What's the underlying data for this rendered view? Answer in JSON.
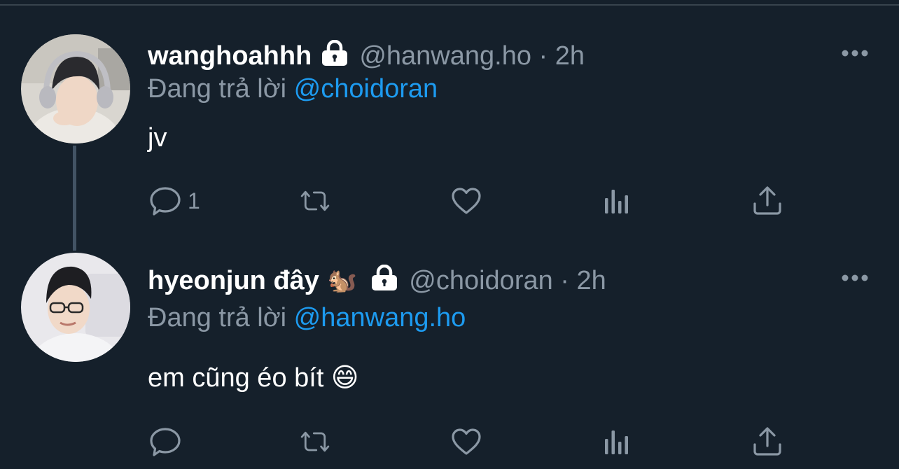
{
  "colors": {
    "background": "#15202b",
    "secondary_text": "#8b98a5",
    "mention": "#1d9bf0",
    "thread_line": "#425364"
  },
  "tweets": [
    {
      "display_name": "wanghoahhh",
      "lock_icon": "lock-icon",
      "handle_time": "@hanwang.ho · 2h",
      "reply_prefix": "Đang trả lời",
      "reply_to": "@choidoran",
      "text": "jv",
      "actions": {
        "reply_count": "1",
        "icons": [
          "reply-icon",
          "retweet-icon",
          "like-icon",
          "analytics-icon",
          "share-icon"
        ]
      }
    },
    {
      "display_name": "hyeonjun đây",
      "name_emoji": "🐿️",
      "lock_icon": "lock-icon",
      "handle_time": "@choidoran · 2h",
      "reply_prefix": "Đang trả lời",
      "reply_to": "@hanwang.ho",
      "text": "em cũng éo bít 😄",
      "actions": {
        "reply_count": "",
        "icons": [
          "reply-icon",
          "retweet-icon",
          "like-icon",
          "analytics-icon",
          "share-icon"
        ]
      }
    }
  ]
}
